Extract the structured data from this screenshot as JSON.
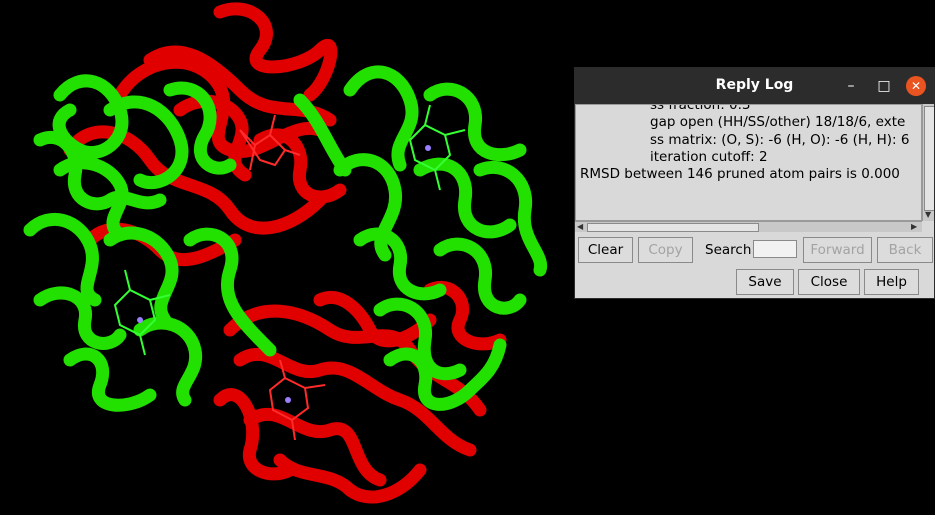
{
  "dialog": {
    "title": "Reply Log",
    "minimize_icon": "minimize-icon",
    "maximize_icon": "maximize-icon",
    "close_icon": "close-icon",
    "log_lines": [
      "ss fraction: 0.3",
      "gap open (HH/SS/other) 18/18/6, exte",
      "ss matrix:  (O, S): -6 (H, O): -6 (H, H): 6",
      "iteration cutoff: 2",
      "RMSD between 146 pruned atom pairs is 0.000"
    ],
    "buttons": {
      "clear": "Clear",
      "copy": "Copy",
      "search_label": "Search:",
      "search_value": "",
      "forward": "Forward",
      "back": "Back",
      "save": "Save",
      "close": "Close",
      "help": "Help"
    }
  },
  "viewer": {
    "colors": {
      "background": "#000000",
      "chain_a": "#ff0000",
      "chain_b": "#00ee00",
      "heme_iron": "#9b7fff"
    }
  }
}
